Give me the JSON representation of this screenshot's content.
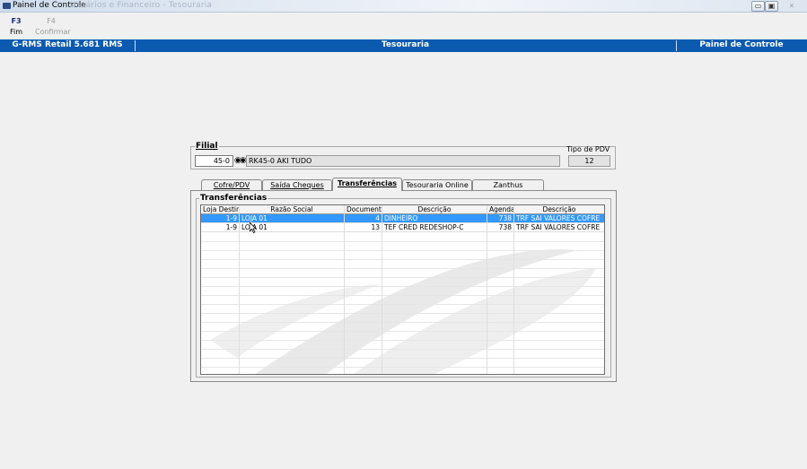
{
  "window": {
    "title": "Painel de Controle",
    "title_extra": "Usuários e Financeiro - Tesouraria",
    "buttons": {
      "minimize": "▭",
      "maximize": "▣",
      "close": "✕"
    }
  },
  "fkeys": [
    {
      "key": "F3",
      "label": "Fim",
      "enabled": true
    },
    {
      "key": "F4",
      "label": "Confirmar",
      "enabled": false
    }
  ],
  "header": {
    "left": "G-RMS Retail 5.681 RMS",
    "center": "Tesouraria",
    "right": "Painel de Controle"
  },
  "filial": {
    "legend": "Filial",
    "code": "45-0",
    "name": "RK45-0 AKI TUDO",
    "tipo_pdv_label": "Tipo de PDV",
    "tipo_pdv_value": "12"
  },
  "tabs": [
    {
      "label": "Cofre/PDV",
      "active": false
    },
    {
      "label": "Saída Cheques",
      "active": false
    },
    {
      "label": "Transferências",
      "active": true
    },
    {
      "label": "Tesouraria Online",
      "active": false
    },
    {
      "label": "Zanthus",
      "active": false
    }
  ],
  "transferencias": {
    "legend": "Transferências",
    "columns": [
      "Loja Destino",
      "Razão Social",
      "Documento",
      "Descrição",
      "Agenda",
      "Descrição"
    ],
    "rows": [
      [
        "1-9",
        "LOJA 01",
        "4",
        "DINHEIRO",
        "738",
        "TRF SAI VALORES COFRE"
      ],
      [
        "1-9",
        "LOJA 01",
        "13",
        "TEF CRED REDESHOP-C",
        "738",
        "TRF SAI VALORES COFRE"
      ]
    ],
    "selected_row": 0
  },
  "colors": {
    "header_bar": "#0a5ab0",
    "selection": "#3399ff",
    "window_bg": "#f0f0f0"
  }
}
